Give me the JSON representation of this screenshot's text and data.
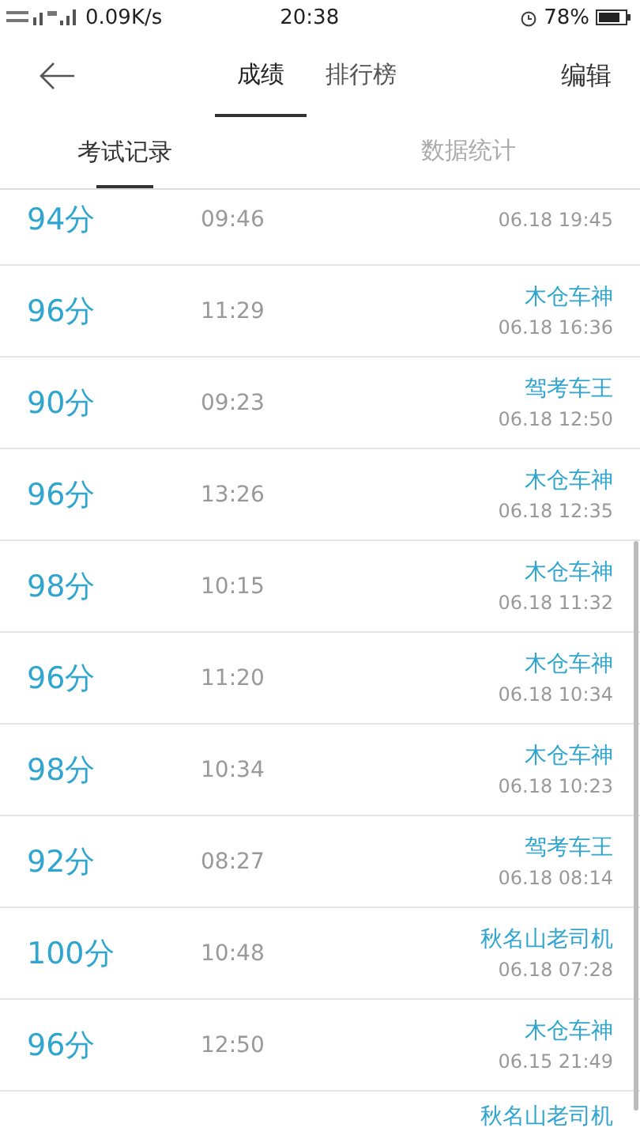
{
  "status_bar": {
    "speed": "0.09K/s",
    "time": "20:38",
    "battery": "78%"
  },
  "nav": {
    "tabs": [
      {
        "label": "成绩",
        "selected": true
      },
      {
        "label": "排行榜",
        "selected": false
      }
    ],
    "action": "编辑"
  },
  "sub_tabs": [
    {
      "label": "考试记录",
      "selected": true
    },
    {
      "label": "数据统计",
      "selected": false
    }
  ],
  "records": [
    {
      "score": "94分",
      "duration": "09:46",
      "date": "06.18  19:45"
    },
    {
      "score": "96分",
      "duration": "11:29",
      "title": "木仓车神",
      "date": "06.18  16:36"
    },
    {
      "score": "90分",
      "duration": "09:23",
      "title": "驾考车王",
      "date": "06.18  12:50"
    },
    {
      "score": "96分",
      "duration": "13:26",
      "title": "木仓车神",
      "date": "06.18  12:35"
    },
    {
      "score": "98分",
      "duration": "10:15",
      "title": "木仓车神",
      "date": "06.18  11:32"
    },
    {
      "score": "96分",
      "duration": "11:20",
      "title": "木仓车神",
      "date": "06.18  10:34"
    },
    {
      "score": "98分",
      "duration": "10:34",
      "title": "木仓车神",
      "date": "06.18  10:23"
    },
    {
      "score": "92分",
      "duration": "08:27",
      "title": "驾考车王",
      "date": "06.18  08:14"
    },
    {
      "score": "100分",
      "duration": "10:48",
      "title": "秋名山老司机",
      "date": "06.18  07:28"
    },
    {
      "score": "96分",
      "duration": "12:50",
      "title": "木仓车神",
      "date": "06.15  21:49"
    },
    {
      "title": "秋名山老司机"
    }
  ]
}
